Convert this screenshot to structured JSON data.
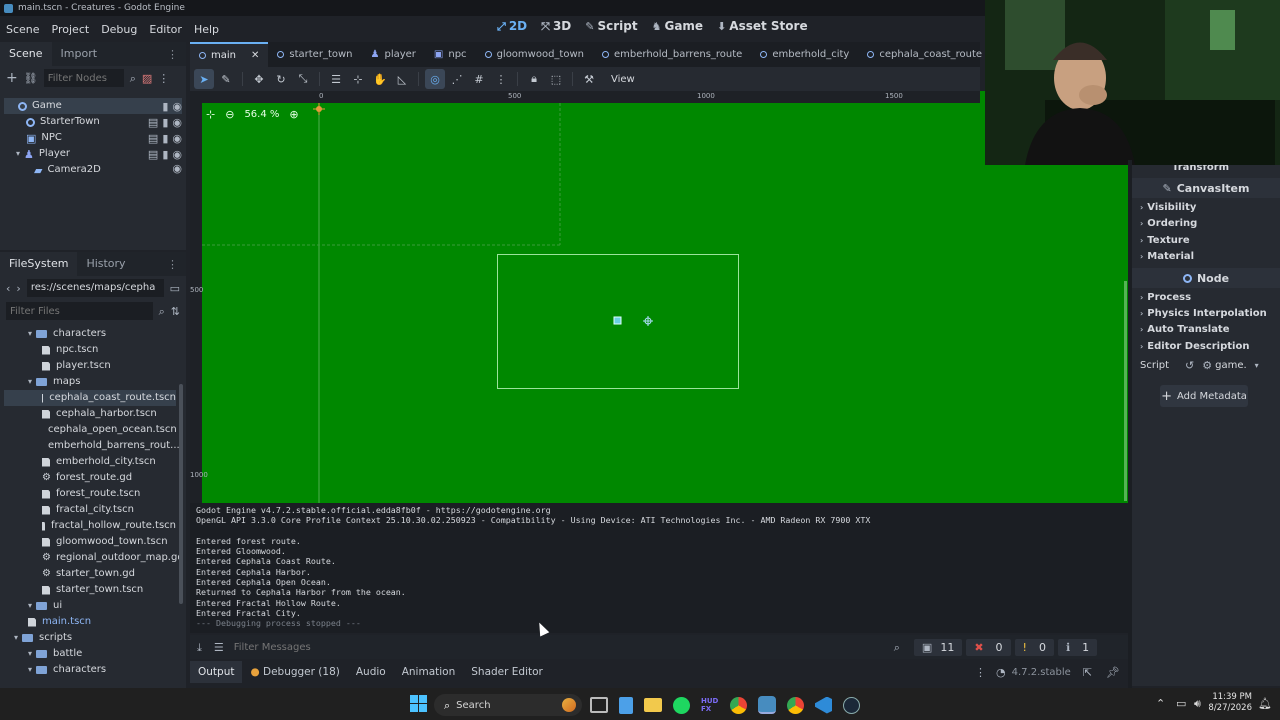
{
  "window": {
    "title": "main.tscn - Creatures - Godot Engine"
  },
  "menus": [
    "Scene",
    "Project",
    "Debug",
    "Editor",
    "Help"
  ],
  "modes": [
    {
      "label": "2D",
      "icon": "2d-icon",
      "active": true
    },
    {
      "label": "3D",
      "icon": "3d-icon",
      "active": false
    },
    {
      "label": "Script",
      "icon": "script-icon",
      "active": false
    },
    {
      "label": "Game",
      "icon": "game-icon",
      "active": false
    },
    {
      "label": "Asset Store",
      "icon": "asset-store-icon",
      "active": false
    }
  ],
  "scene_dock": {
    "tabs": [
      "Scene",
      "Import"
    ],
    "filter_placeholder": "Filter Nodes",
    "nodes": [
      {
        "label": "Game",
        "icon": "node2d-icon",
        "depth": 0,
        "selected": true
      },
      {
        "label": "StarterTown",
        "icon": "node2d-icon",
        "depth": 1
      },
      {
        "label": "NPC",
        "icon": "npc-icon",
        "depth": 1
      },
      {
        "label": "Player",
        "icon": "player-icon",
        "depth": 1
      },
      {
        "label": "Camera2D",
        "icon": "camera2d-icon",
        "depth": 2
      }
    ]
  },
  "filesystem_dock": {
    "tabs": [
      "FileSystem",
      "History"
    ],
    "path": "res://scenes/maps/cepha",
    "filter_placeholder": "Filter Files",
    "items": [
      {
        "label": "characters",
        "type": "folder",
        "depth": 1
      },
      {
        "label": "npc.tscn",
        "type": "scene",
        "depth": 2
      },
      {
        "label": "player.tscn",
        "type": "scene",
        "depth": 2
      },
      {
        "label": "maps",
        "type": "folder",
        "depth": 1
      },
      {
        "label": "cephala_coast_route.tscn",
        "type": "scene",
        "depth": 2,
        "selected": true
      },
      {
        "label": "cephala_harbor.tscn",
        "type": "scene",
        "depth": 2
      },
      {
        "label": "cephala_open_ocean.tscn",
        "type": "scene",
        "depth": 2
      },
      {
        "label": "emberhold_barrens_rout...",
        "type": "scene",
        "depth": 2
      },
      {
        "label": "emberhold_city.tscn",
        "type": "scene",
        "depth": 2
      },
      {
        "label": "forest_route.gd",
        "type": "script",
        "depth": 2
      },
      {
        "label": "forest_route.tscn",
        "type": "scene",
        "depth": 2
      },
      {
        "label": "fractal_city.tscn",
        "type": "scene",
        "depth": 2
      },
      {
        "label": "fractal_hollow_route.tscn",
        "type": "scene",
        "depth": 2
      },
      {
        "label": "gloomwood_town.tscn",
        "type": "scene",
        "depth": 2
      },
      {
        "label": "regional_outdoor_map.gd",
        "type": "script",
        "depth": 2
      },
      {
        "label": "starter_town.gd",
        "type": "script",
        "depth": 2
      },
      {
        "label": "starter_town.tscn",
        "type": "scene",
        "depth": 2
      },
      {
        "label": "ui",
        "type": "folder",
        "depth": 1
      },
      {
        "label": "main.tscn",
        "type": "scene-blue",
        "depth": 1
      },
      {
        "label": "scripts",
        "type": "folder",
        "depth": 0
      },
      {
        "label": "battle",
        "type": "folder",
        "depth": 1
      },
      {
        "label": "characters",
        "type": "folder",
        "depth": 1
      }
    ]
  },
  "scene_tabs": [
    {
      "label": "main",
      "active": true
    },
    {
      "label": "starter_town"
    },
    {
      "label": "player"
    },
    {
      "label": "npc"
    },
    {
      "label": "gloomwood_town"
    },
    {
      "label": "emberhold_barrens_route"
    },
    {
      "label": "emberhold_city"
    },
    {
      "label": "cephala_coast_route"
    }
  ],
  "toolbar": {
    "view_label": "View"
  },
  "viewport": {
    "zoom": "56.4 %",
    "ruler_labels_top": [
      "0",
      "500",
      "1000",
      "1500"
    ],
    "ruler_labels_left": [
      "500",
      "1000"
    ],
    "background": "#008800"
  },
  "inspector": {
    "sections_top": [
      {
        "header": "Transform"
      },
      {
        "header": "CanvasItem"
      }
    ],
    "canvas_item_props": [
      "Visibility",
      "Ordering",
      "Texture",
      "Material"
    ],
    "node_header": "Node",
    "node_props": [
      "Process",
      "Physics Interpolation",
      "Auto Translate",
      "Editor Description"
    ],
    "script_label": "Script",
    "script_value": "game.",
    "add_metadata": "Add Metadata"
  },
  "output": {
    "lines": [
      {
        "text": "Godot Engine v4.7.2.stable.official.edda8fb0f - https://godotengine.org",
        "dim": false
      },
      {
        "text": "OpenGL API 3.3.0 Core Profile Context 25.10.30.02.250923 - Compatibility - Using Device: ATI Technologies Inc. - AMD Radeon RX 7900 XTX",
        "dim": false
      },
      {
        "text": "",
        "dim": false
      },
      {
        "text": "Entered forest route.",
        "dim": false
      },
      {
        "text": "Entered Gloomwood.",
        "dim": false
      },
      {
        "text": "Entered Cephala Coast Route.",
        "dim": false
      },
      {
        "text": "Entered Cephala Harbor.",
        "dim": false
      },
      {
        "text": "Entered Cephala Open Ocean.",
        "dim": false
      },
      {
        "text": "Returned to Cephala Harbor from the ocean.",
        "dim": false
      },
      {
        "text": "Entered Fractal Hollow Route.",
        "dim": false
      },
      {
        "text": "Entered Fractal City.",
        "dim": false
      },
      {
        "text": "--- Debugging process stopped ---",
        "dim": true
      }
    ],
    "filter_placeholder": "Filter Messages",
    "counts": {
      "messages": "11",
      "errors": "0",
      "warnings": "0",
      "info": "1"
    }
  },
  "bottom_tabs": [
    {
      "label": "Output",
      "active": true
    },
    {
      "label": "Debugger (18)",
      "dot": true
    },
    {
      "label": "Audio"
    },
    {
      "label": "Animation"
    },
    {
      "label": "Shader Editor"
    }
  ],
  "version": "4.7.2.stable",
  "taskbar": {
    "search_label": "Search",
    "time": "11:39 PM",
    "date": "8/27/2026",
    "apps": [
      "start-icon",
      "search-icon",
      "copilot-icon",
      "task-view-icon",
      "notepad-icon",
      "file-explorer-icon",
      "spotify-icon",
      "hud-icon",
      "chrome-icon",
      "godot-icon",
      "chrome-alt-icon",
      "vscode-icon",
      "steam-icon"
    ]
  }
}
